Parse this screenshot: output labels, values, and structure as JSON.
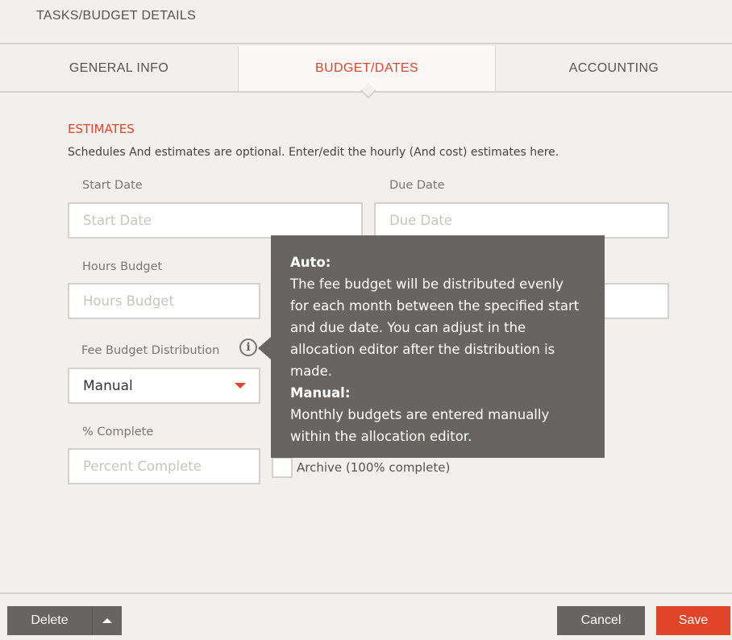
{
  "header": {
    "title": "TASKS/BUDGET DETAILS"
  },
  "tabs": [
    {
      "label": "GENERAL INFO"
    },
    {
      "label": "BUDGET/DATES",
      "active": true
    },
    {
      "label": "ACCOUNTING"
    }
  ],
  "section": {
    "title": "ESTIMATES",
    "description": "Schedules And estimates are optional. Enter/edit the hourly (And cost) estimates here."
  },
  "fields": {
    "start_date": {
      "label": "Start Date",
      "placeholder": "Start Date",
      "value": ""
    },
    "due_date": {
      "label": "Due Date",
      "placeholder": "Due Date",
      "value": ""
    },
    "hours_budget": {
      "label": "Hours Budget",
      "placeholder": "Hours Budget",
      "value": ""
    },
    "fee_distribution": {
      "label": "Fee Budget Distribution",
      "value": "Manual"
    },
    "percent_complete": {
      "label": "% Complete",
      "placeholder": "Percent Complete",
      "value": ""
    },
    "archive": {
      "label": "Archive (100% complete)",
      "checked": false
    }
  },
  "tooltip": {
    "auto_title": "Auto:",
    "auto_text": "The fee budget will be distributed evenly for each month between the specified start and due date. You can adjust in the allocation editor after the distribution is made.",
    "manual_title": "Manual:",
    "manual_text": "Monthly budgets are entered manually within the allocation editor."
  },
  "footer": {
    "delete_label": "Delete",
    "cancel_label": "Cancel",
    "save_label": "Save"
  },
  "colors": {
    "accent": "#e0452a",
    "button_grey": "#686462",
    "background": "#f3efec"
  }
}
